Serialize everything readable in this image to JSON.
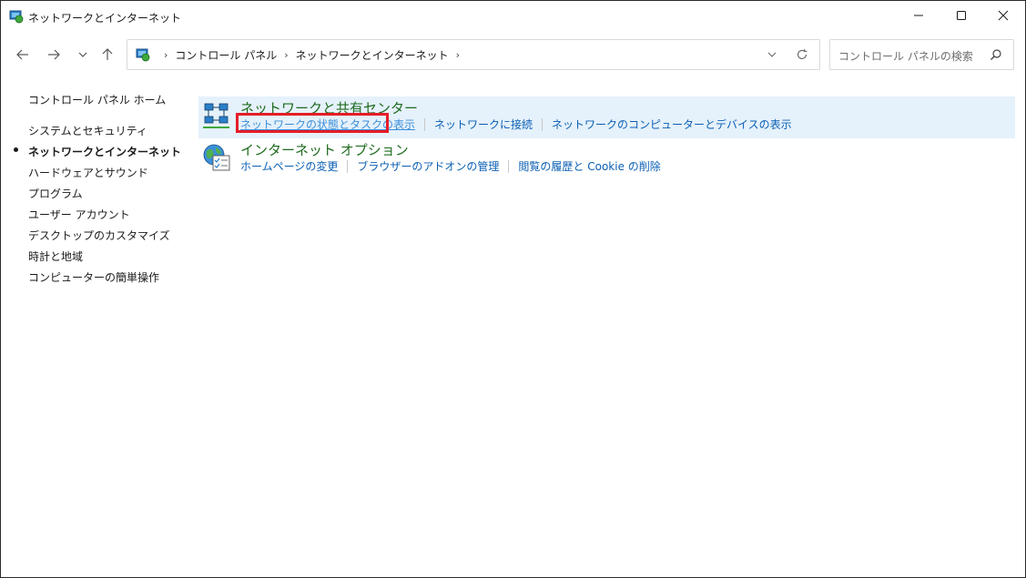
{
  "window": {
    "title": "ネットワークとインターネット"
  },
  "titlebar": {
    "minimize_icon": "minimize-icon",
    "maximize_icon": "maximize-icon",
    "close_icon": "close-icon"
  },
  "navbar": {
    "breadcrumb": [
      "コントロール パネル",
      "ネットワークとインターネット"
    ],
    "search_placeholder": "コントロール パネルの検索"
  },
  "left_pane": {
    "home": "コントロール パネル ホーム",
    "items": [
      {
        "label": "システムとセキュリティ",
        "active": false
      },
      {
        "label": "ネットワークとインターネット",
        "active": true
      },
      {
        "label": "ハードウェアとサウンド",
        "active": false
      },
      {
        "label": "プログラム",
        "active": false
      },
      {
        "label": "ユーザー アカウント",
        "active": false
      },
      {
        "label": "デスクトップのカスタマイズ",
        "active": false
      },
      {
        "label": "時計と地域",
        "active": false
      },
      {
        "label": "コンピューターの簡単操作",
        "active": false
      }
    ]
  },
  "categories": [
    {
      "title": "ネットワークと共有センター",
      "icon": "network-sharing-center-icon",
      "links": [
        "ネットワークの状態とタスクの表示",
        "ネットワークに接続",
        "ネットワークのコンピューターとデバイスの表示"
      ]
    },
    {
      "title": "インターネット オプション",
      "icon": "internet-options-icon",
      "links": [
        "ホームページの変更",
        "ブラウザーのアドオンの管理",
        "閲覧の履歴と Cookie の削除"
      ]
    }
  ],
  "colors": {
    "category_title": "#1e6b1e",
    "link": "#0a5fb4",
    "highlight_bg": "#e5f1fb",
    "annotation_box": "#e51d28"
  }
}
